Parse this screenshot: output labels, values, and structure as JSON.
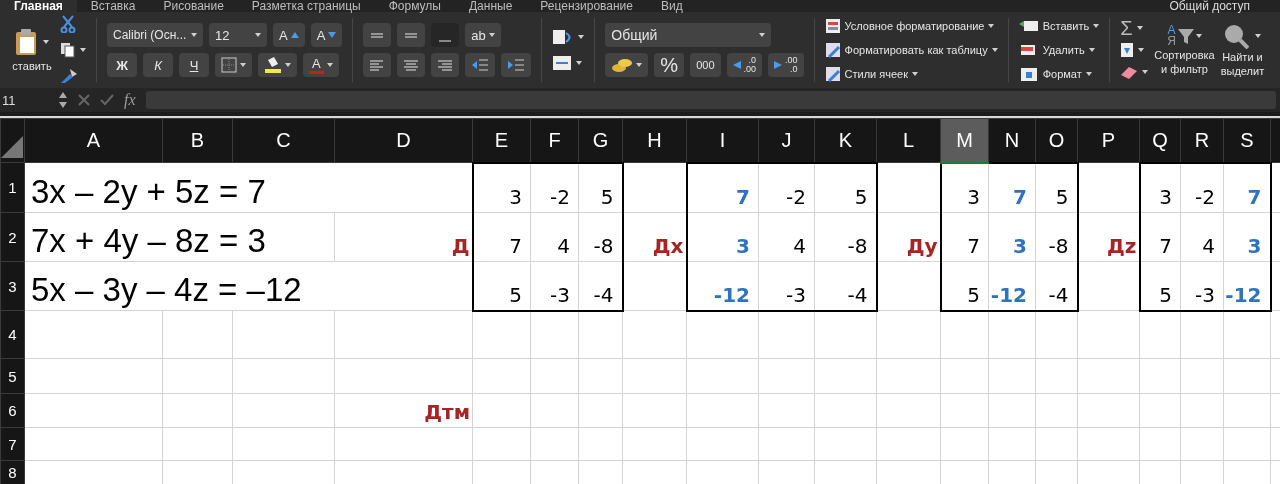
{
  "tabs": [
    {
      "label": "Главная",
      "selected": true
    },
    {
      "label": "Вставка",
      "selected": false
    },
    {
      "label": "Рисование",
      "selected": false
    },
    {
      "label": "Разметка страницы",
      "selected": false
    },
    {
      "label": "Формулы",
      "selected": false
    },
    {
      "label": "Данные",
      "selected": false
    },
    {
      "label": "Рецензирование",
      "selected": false
    },
    {
      "label": "Вид",
      "selected": false
    }
  ],
  "share": "Общий доступ",
  "clipboard": {
    "paste": "ставить"
  },
  "font": {
    "name": "Calibri (Осн...",
    "size": "12",
    "grow": "A",
    "shrink": "A",
    "bold": "Ж",
    "italic": "К",
    "underline": "Ч",
    "color_letter": "A"
  },
  "alignment": {
    "orientation": "ab"
  },
  "number": {
    "format": "Общий",
    "percent": "%",
    "thousands": "000",
    "increase": [
      ".0",
      ".00"
    ],
    "decrease": [
      ".00",
      ".0"
    ]
  },
  "styles": [
    "Условное форматирование",
    "Форматировать как таблицу",
    "Стили ячеек"
  ],
  "cells_group": [
    "Вставить",
    "Удалить",
    "Формат"
  ],
  "editing": {
    "sum": "Σ",
    "sort_letters": [
      "А",
      "Я"
    ],
    "sort": [
      "Сортировка",
      "и фильтр"
    ],
    "find": [
      "Найти и",
      "выделит"
    ]
  },
  "formula_bar": {
    "name_box": "11",
    "fx": "fx"
  },
  "columns": [
    {
      "label": "A",
      "selected": false
    },
    {
      "label": "B",
      "selected": false
    },
    {
      "label": "C",
      "selected": false
    },
    {
      "label": "D",
      "selected": false
    },
    {
      "label": "E",
      "selected": false
    },
    {
      "label": "F",
      "selected": false
    },
    {
      "label": "G",
      "selected": false
    },
    {
      "label": "H",
      "selected": false
    },
    {
      "label": "I",
      "selected": false
    },
    {
      "label": "J",
      "selected": false
    },
    {
      "label": "K",
      "selected": false
    },
    {
      "label": "L",
      "selected": false
    },
    {
      "label": "M",
      "selected": true
    },
    {
      "label": "N",
      "selected": false
    },
    {
      "label": "O",
      "selected": false
    },
    {
      "label": "P",
      "selected": false
    },
    {
      "label": "Q",
      "selected": false
    },
    {
      "label": "R",
      "selected": false
    },
    {
      "label": "S",
      "selected": false
    }
  ],
  "rows": [
    {
      "header": "1",
      "cells": [
        {
          "kind": "equation",
          "text": "3x – 2y + 5z = 7"
        },
        {
          "kind": "empty"
        },
        {
          "kind": "empty"
        },
        {
          "kind": "empty"
        },
        {
          "kind": "number",
          "text": "3"
        },
        {
          "kind": "number",
          "text": "-2"
        },
        {
          "kind": "number",
          "text": "5"
        },
        {
          "kind": "empty"
        },
        {
          "kind": "substituted",
          "text": "7"
        },
        {
          "kind": "number",
          "text": "-2"
        },
        {
          "kind": "number",
          "text": "5"
        },
        {
          "kind": "empty"
        },
        {
          "kind": "number",
          "text": "3"
        },
        {
          "kind": "substituted",
          "text": "7"
        },
        {
          "kind": "number",
          "text": "5"
        },
        {
          "kind": "empty"
        },
        {
          "kind": "number",
          "text": "3"
        },
        {
          "kind": "number",
          "text": "-2"
        },
        {
          "kind": "substituted",
          "text": "7"
        }
      ]
    },
    {
      "header": "2",
      "cells": [
        {
          "kind": "equation",
          "text": "7x + 4y – 8z = 3"
        },
        {
          "kind": "empty"
        },
        {
          "kind": "empty"
        },
        {
          "kind": "label",
          "text": "Д"
        },
        {
          "kind": "number",
          "text": "7"
        },
        {
          "kind": "number",
          "text": "4"
        },
        {
          "kind": "number",
          "text": "-8"
        },
        {
          "kind": "label",
          "text": "Дх"
        },
        {
          "kind": "substituted",
          "text": "3"
        },
        {
          "kind": "number",
          "text": "4"
        },
        {
          "kind": "number",
          "text": "-8"
        },
        {
          "kind": "label",
          "text": "Ду"
        },
        {
          "kind": "number",
          "text": "7"
        },
        {
          "kind": "substituted",
          "text": "3"
        },
        {
          "kind": "number",
          "text": "-8"
        },
        {
          "kind": "label",
          "text": "Дz"
        },
        {
          "kind": "number",
          "text": "7"
        },
        {
          "kind": "number",
          "text": "4"
        },
        {
          "kind": "substituted",
          "text": "3"
        }
      ]
    },
    {
      "header": "3",
      "cells": [
        {
          "kind": "equation",
          "text": "5x – 3y – 4z = –12"
        },
        {
          "kind": "empty"
        },
        {
          "kind": "empty"
        },
        {
          "kind": "empty"
        },
        {
          "kind": "number",
          "text": "5"
        },
        {
          "kind": "number",
          "text": "-3"
        },
        {
          "kind": "number",
          "text": "-4"
        },
        {
          "kind": "empty"
        },
        {
          "kind": "substituted",
          "text": "-12"
        },
        {
          "kind": "number",
          "text": "-3"
        },
        {
          "kind": "number",
          "text": "-4"
        },
        {
          "kind": "empty"
        },
        {
          "kind": "number",
          "text": "5"
        },
        {
          "kind": "substituted",
          "text": "-12"
        },
        {
          "kind": "number",
          "text": "-4"
        },
        {
          "kind": "empty"
        },
        {
          "kind": "number",
          "text": "5"
        },
        {
          "kind": "number",
          "text": "-3"
        },
        {
          "kind": "substituted",
          "text": "-12"
        }
      ]
    },
    {
      "header": "4"
    },
    {
      "header": "5"
    },
    {
      "header": "6",
      "cells": [
        {
          "kind": "empty"
        },
        {
          "kind": "empty"
        },
        {
          "kind": "empty"
        },
        {
          "kind": "label",
          "text": "Дтм"
        }
      ]
    },
    {
      "header": "7"
    },
    {
      "header": "8"
    }
  ]
}
